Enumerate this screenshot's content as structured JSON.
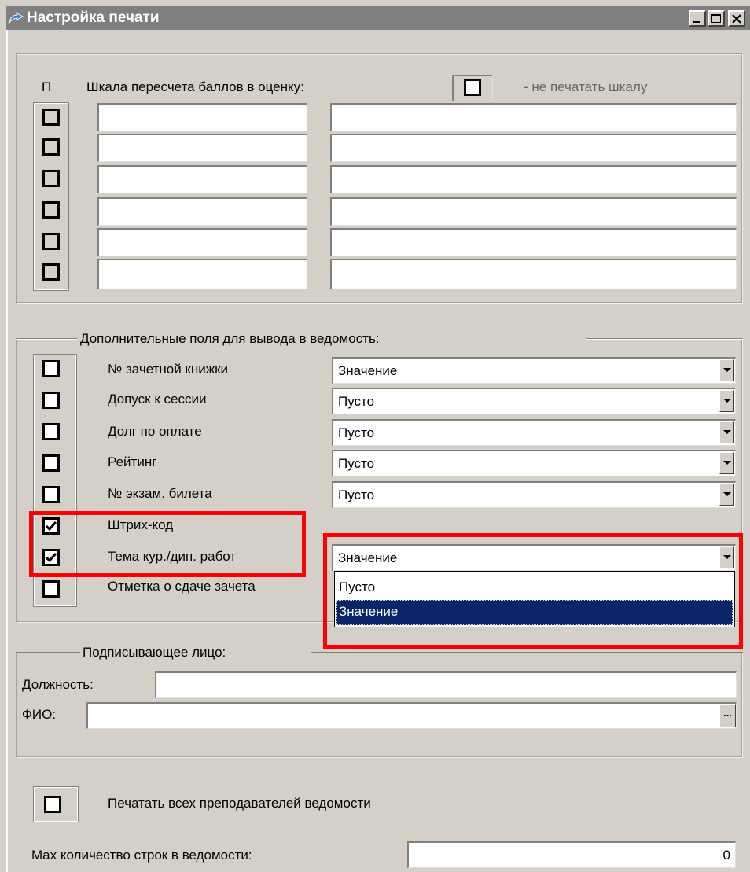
{
  "window": {
    "title": "Настройка печати",
    "controls": {
      "minimize": "minimize-icon",
      "maximize": "maximize-icon",
      "close": "close-icon"
    }
  },
  "scale": {
    "col_header": "П",
    "label": "Шкала пересчета баллов в оценку:",
    "no_print_label": "- не печатать шкалу",
    "no_print_checked": false,
    "rows": [
      {
        "checked": false,
        "from": "",
        "text": ""
      },
      {
        "checked": false,
        "from": "",
        "text": ""
      },
      {
        "checked": false,
        "from": "",
        "text": ""
      },
      {
        "checked": false,
        "from": "",
        "text": ""
      },
      {
        "checked": false,
        "from": "",
        "text": ""
      },
      {
        "checked": false,
        "from": "",
        "text": ""
      }
    ]
  },
  "extra_fields": {
    "legend": "Дополнительные поля для вывода в ведомость:",
    "rows": [
      {
        "label": "№ зачетной книжки",
        "checked": false,
        "value": "Значение"
      },
      {
        "label": "Допуск к сессии",
        "checked": false,
        "value": "Пусто"
      },
      {
        "label": "Долг по оплате",
        "checked": false,
        "value": "Пусто"
      },
      {
        "label": "Рейтинг",
        "checked": false,
        "value": "Пусто"
      },
      {
        "label": "№ экзам. билета",
        "checked": false,
        "value": "Пусто"
      },
      {
        "label": "Штрих-код",
        "checked": true
      },
      {
        "label": "Тема кур./дип. работ",
        "checked": true,
        "value": "Значение"
      },
      {
        "label": "Отметка о сдаче зачета",
        "checked": false
      }
    ],
    "dropdown_options": [
      "Пусто",
      "Значение"
    ],
    "dropdown_selected": "Значение"
  },
  "signer": {
    "legend": "Подписывающее лицо:",
    "position_label": "Должность:",
    "position_value": "",
    "name_label": "ФИО:",
    "name_value": "",
    "browse_label": "..."
  },
  "print_all_teachers": {
    "label": "Печатать всех преподавателей ведомости",
    "checked": false
  },
  "max_rows": {
    "label": "Max количество строк в ведомости:",
    "value": "0"
  },
  "colors": {
    "highlight": "#ff0000",
    "selection": "#0a246a",
    "window_bg": "#d4d0c8",
    "titlebar": "#7f7f7f"
  }
}
